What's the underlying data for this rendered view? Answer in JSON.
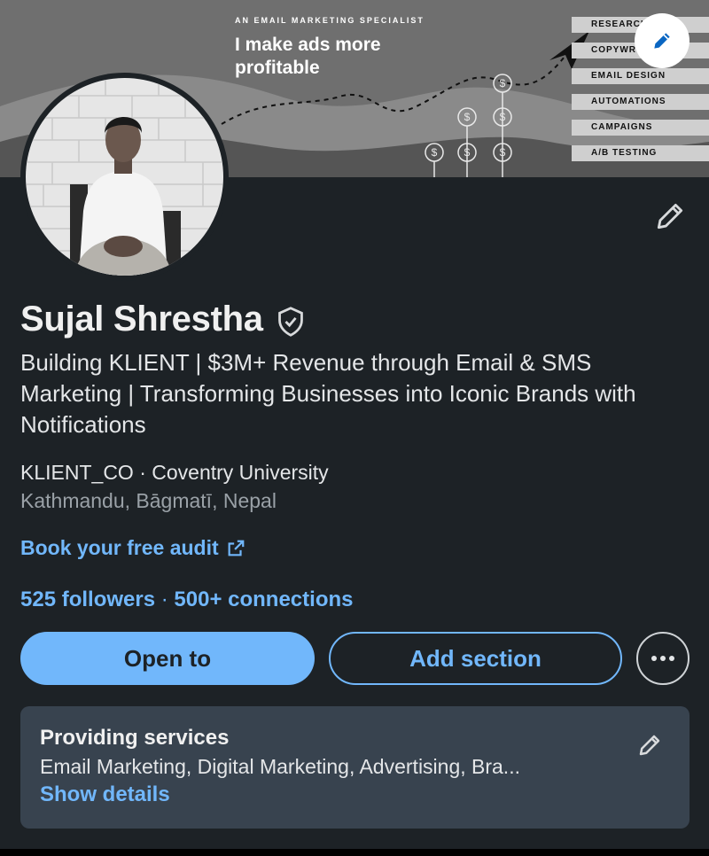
{
  "banner": {
    "tagline": "AN EMAIL MARKETING SPECIALIST",
    "headline_line1": "I make ads more",
    "headline_line2": "profitable",
    "skills": [
      "RESEARCH",
      "COPYWR",
      "EMAIL DESIGN",
      "AUTOMATIONS",
      "CAMPAIGNS",
      "A/B TESTING"
    ],
    "edit_icon": "pencil-icon"
  },
  "profile": {
    "name": "Sujal Shrestha",
    "verified_icon": "verified-shield-icon",
    "headline": "Building KLIENT | $3M+ Revenue through Email & SMS Marketing | Transforming Businesses into Iconic Brands with Notifications",
    "company": "KLIENT_CO · Coventry University",
    "location": "Kathmandu, Bāgmatī, Nepal",
    "link_text": "Book your free audit",
    "followers": "525 followers",
    "separator": "·",
    "connections": "500+ connections"
  },
  "actions": {
    "open_to": "Open to",
    "add_section": "Add section",
    "more_icon": "more-horizontal-icon"
  },
  "services": {
    "title": "Providing services",
    "list": "Email Marketing, Digital Marketing, Advertising, Bra...",
    "show_details": "Show details"
  },
  "colors": {
    "background": "#1d2226",
    "accent": "#71b7fb",
    "card": "#38434f"
  }
}
